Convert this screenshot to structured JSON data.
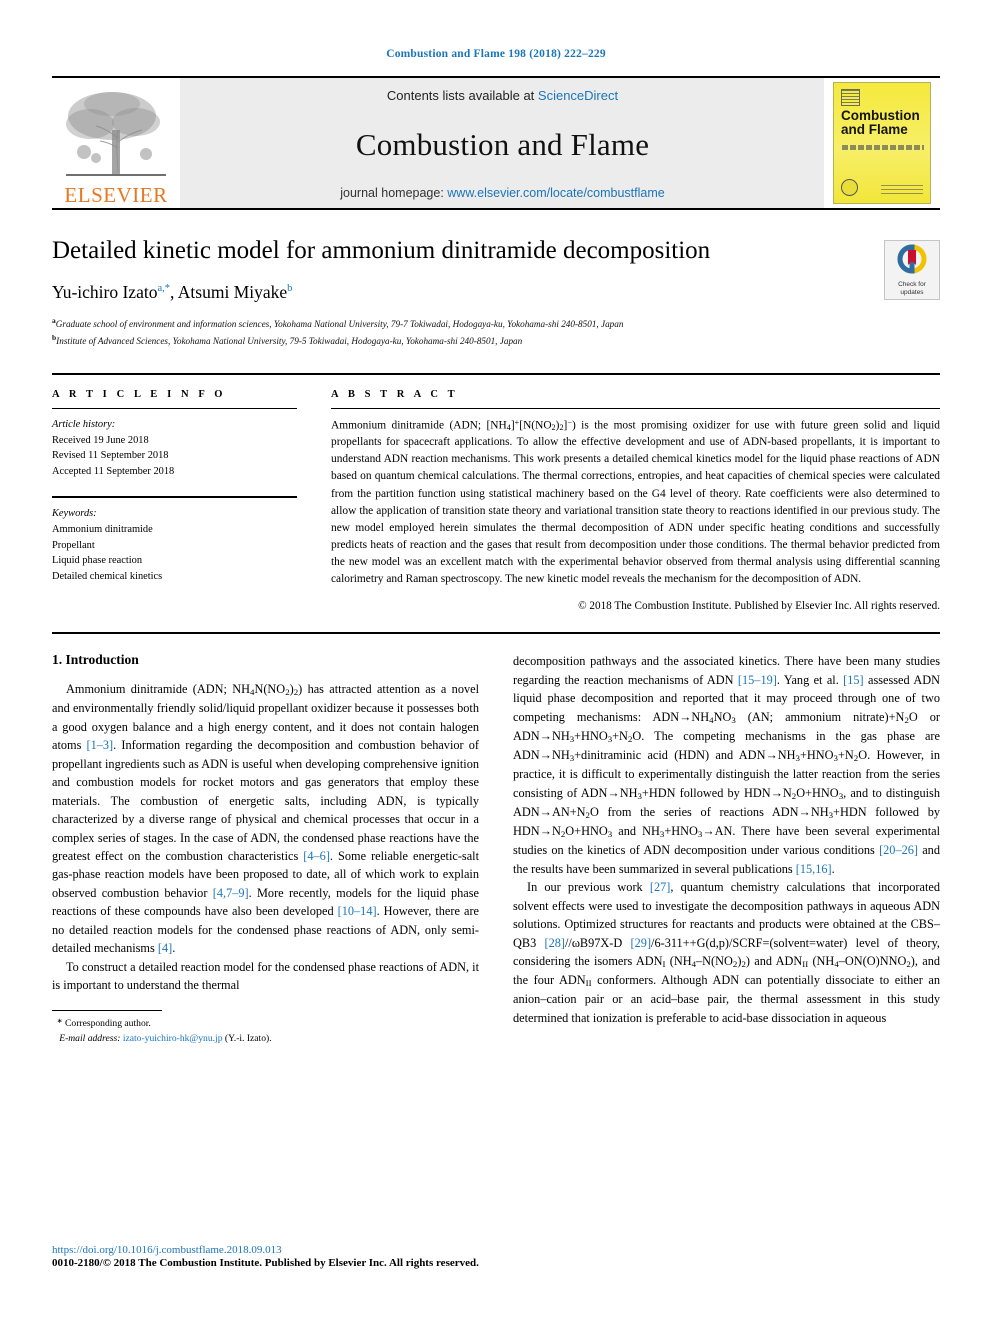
{
  "running_head": "Combustion and Flame 198 (2018) 222–229",
  "masthead": {
    "contents_prefix": "Contents lists available at ",
    "contents_link": "ScienceDirect",
    "journal_name": "Combustion and Flame",
    "homepage_prefix": "journal homepage: ",
    "homepage_link": "www.elsevier.com/locate/combustflame",
    "publisher_wordmark": "ELSEVIER",
    "cover_title": "Combustion and Flame",
    "link_color": "#1b75bb",
    "publisher_color": "#e87722",
    "cover_color": "#f5e93d"
  },
  "article": {
    "title": "Detailed kinetic model for ammonium dinitramide decomposition",
    "authors": "Yu-ichiro Izato",
    "author1_marks": "a,*",
    "author2": ", Atsumi Miyake",
    "author2_marks": "b",
    "affiliation_a": "Graduate school of environment and information sciences, Yokohama National University, 79-7 Tokiwadai, Hodogaya-ku, Yokohama-shi 240-8501, Japan",
    "affiliation_b": "Institute of Advanced Sciences, Yokohama National University, 79-5 Tokiwadai, Hodogaya-ku, Yokohama-shi 240-8501, Japan",
    "affil_mark_a": "a",
    "affil_mark_b": "b"
  },
  "crossmark": {
    "line1": "Check for",
    "line2": "updates"
  },
  "info": {
    "heading": "A R T I C L E   I N F O",
    "history_label": "Article history:",
    "received": "Received 19 June 2018",
    "revised": "Revised 11 September 2018",
    "accepted": "Accepted 11 September 2018",
    "keywords_label": "Keywords:",
    "keywords": [
      "Ammonium dinitramide",
      "Propellant",
      "Liquid phase reaction",
      "Detailed chemical kinetics"
    ]
  },
  "abstract": {
    "heading": "A B S T R A C T",
    "text_part1": "Ammonium dinitramide (ADN; [NH",
    "text_part2": ") is the most promising oxidizer for use with future green solid and liquid propellants for spacecraft applications. To allow the effective development and use of ADN-based propellants, it is important to understand ADN reaction mechanisms. This work presents a detailed chemical kinetics model for the liquid phase reactions of ADN based on quantum chemical calculations. The thermal corrections, entropies, and heat capacities of chemical species were calculated from the partition function using statistical machinery based on the G4 level of theory. Rate coefficients were also determined to allow the application of transition state theory and variational transition state theory to reactions identified in our previous study. The new model employed herein simulates the thermal decomposition of ADN under specific heating conditions and successfully predicts heats of reaction and the gases that result from decomposition under those conditions. The thermal behavior predicted from the new model was an excellent match with the experimental behavior observed from thermal analysis using differential scanning calorimetry and Raman spectroscopy. The new kinetic model reveals the mechanism for the decomposition of ADN.",
    "copyright": "© 2018 The Combustion Institute. Published by Elsevier Inc. All rights reserved."
  },
  "body": {
    "section_number_title": "1. Introduction",
    "left_para1_a": "Ammonium dinitramide (ADN; NH",
    "left_para1_b": ") has attracted attention as a novel and environmentally friendly solid/liquid propellant oxidizer because it possesses both a good oxygen balance and a high energy content, and it does not contain halogen atoms ",
    "cit_1_3": "[1–3]",
    "left_para1_c": ". Information regarding the decomposition and combustion behavior of propellant ingredients such as ADN is useful when developing comprehensive ignition and combustion models for rocket motors and gas generators that employ these materials. The combustion of energetic salts, including ADN, is typically characterized by a diverse range of physical and chemical processes that occur in a complex series of stages. In the case of ADN, the condensed phase reactions have the greatest effect on the combustion characteristics ",
    "cit_4_6": "[4–6]",
    "left_para1_d": ". Some reliable energetic-salt gas-phase reaction models have been proposed to date, all of which work to explain observed combustion behavior ",
    "cit_4_7_9": "[4,7–9]",
    "left_para1_e": ". More recently, models for the liquid phase reactions of these compounds have also been developed ",
    "cit_10_14": "[10–14]",
    "left_para1_f": ". However, there are no detailed reaction models for the condensed phase reactions of ADN, only semi-detailed mechanisms ",
    "cit_4": "[4]",
    "left_para1_g": ".",
    "left_para2": "To construct a detailed reaction model for the condensed phase reactions of ADN, it is important to understand the thermal",
    "right_para1_a": "decomposition pathways and the associated kinetics. There have been many studies regarding the reaction mechanisms of ADN ",
    "cit_15_19": "[15–19]",
    "right_para1_b": ". Yang et al. ",
    "cit_15": "[15]",
    "right_para1_c": " assessed ADN liquid phase decomposition and reported that it may proceed through one of two competing mechanisms: ADN→NH",
    "right_para1_d": " (AN; ammonium nitrate)+N",
    "right_para1_e": "O or ADN→NH",
    "right_para1_f": "O. The competing mechanisms in the gas phase are ADN→NH",
    "right_para1_g": "+dinitraminic acid (HDN) and ADN→NH",
    "right_para1_h": "O. However, in practice, it is difficult to experimentally distinguish the latter reaction from the series consisting of ADN→NH",
    "right_para1_i": "+HDN followed by HDN→N",
    "right_para1_j": ", and to distinguish ADN→AN+N",
    "right_para1_k": "O from the series of reactions ADN→NH",
    "right_para1_l": "→AN. There have been several experimental studies on the kinetics of ADN decomposition under various conditions ",
    "cit_20_26": "[20–26]",
    "right_para1_m": " and the results have been summarized in several publications ",
    "cit_15_16": "[15,16]",
    "right_para1_n": ".",
    "right_para2_a": "In our previous work ",
    "cit_27": "[27]",
    "right_para2_b": ", quantum chemistry calculations that incorporated solvent effects were used to investigate the decomposition pathways in aqueous ADN solutions. Optimized structures for reactants and products were obtained at the CBS–QB3 ",
    "cit_28": "[28]",
    "right_para2_c": "//ωB97X-D ",
    "cit_29": "[29]",
    "right_para2_d": "/6-311++G(d,p)/SCRF=(solvent=water) level of theory, considering the isomers ADN",
    "right_para2_e": " (NH",
    "right_para2_f": "), and the four ADN",
    "right_para2_g": " conformers. Although ADN can potentially dissociate to either an anion–cation pair or an acid–base pair, the thermal assessment in this study determined that ionization is preferable to acid-base dissociation in aqueous"
  },
  "footnote": {
    "corresponding": "Corresponding author.",
    "email_label": "E-mail address:",
    "email": "izato-yuichiro-hk@ynu.jp",
    "email_suffix": "(Y.-i. Izato)."
  },
  "doi": {
    "url": "https://doi.org/10.1016/j.combustflame.2018.09.013",
    "copyright": "0010-2180/© 2018 The Combustion Institute. Published by Elsevier Inc. All rights reserved."
  }
}
